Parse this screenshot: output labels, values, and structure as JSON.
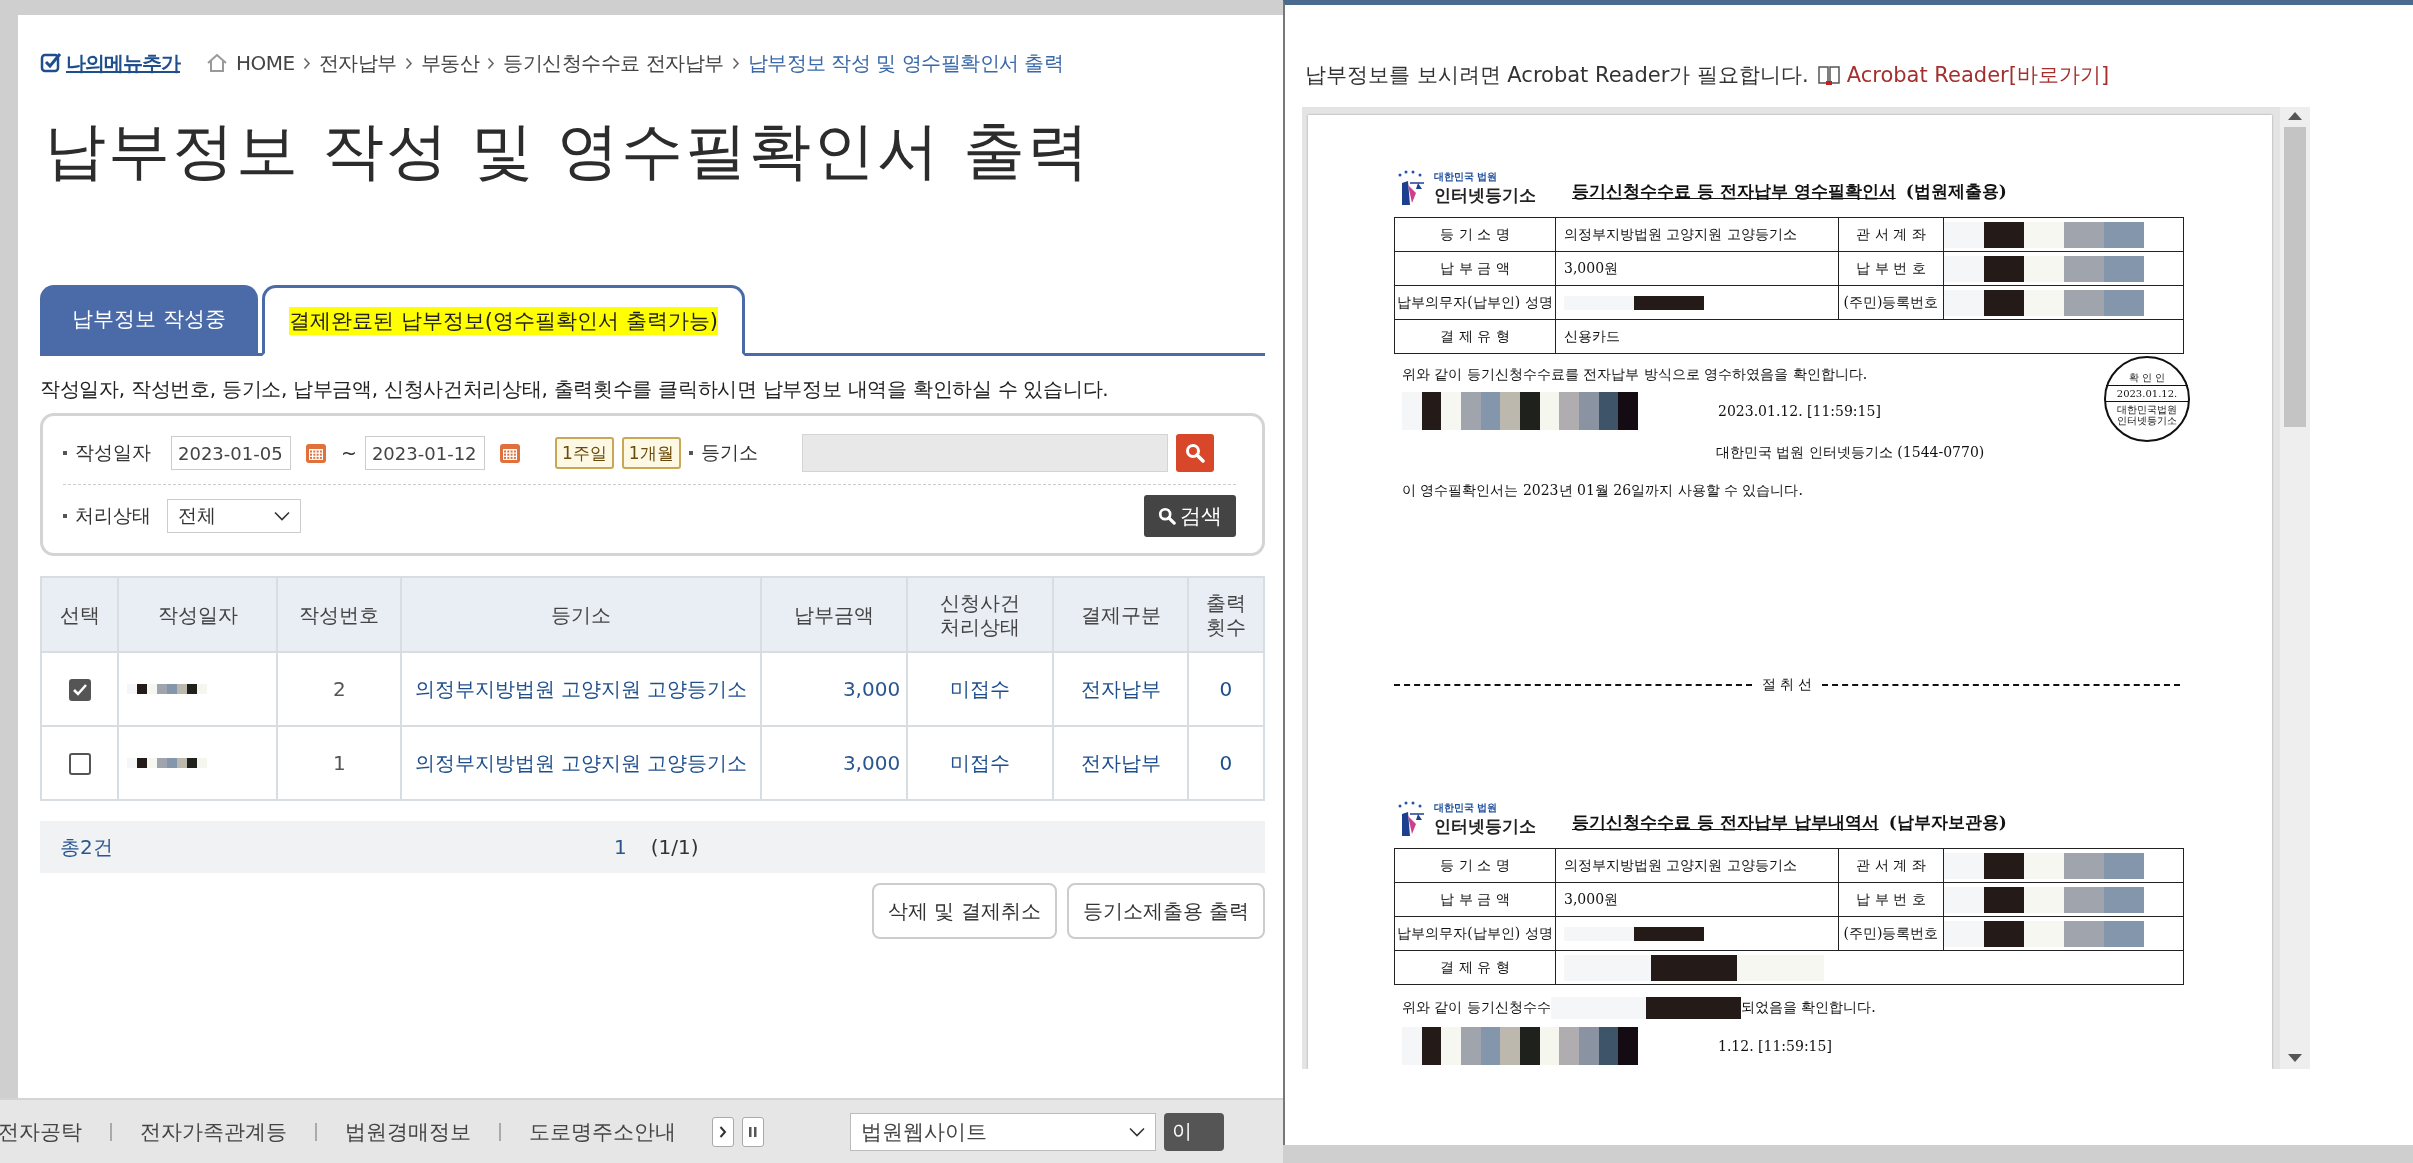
{
  "page": {
    "my_menu": "나의메뉴추가",
    "breadcrumb": [
      "HOME",
      "전자납부",
      "부동산",
      "등기신청수수료 전자납부",
      "납부정보 작성 및 영수필확인서 출력"
    ],
    "title": "납부정보 작성 및 영수필확인서 출력",
    "tabs": [
      {
        "label": "납부정보 작성중",
        "selected": false
      },
      {
        "label": "결제완료된 납부정보(영수필확인서 출력가능)",
        "selected": true
      }
    ],
    "instruction": "작성일자, 작성번호, 등기소, 납부금액, 신청사건처리상태, 출력횟수를 클릭하시면 납부정보 내역을 확인하실 수 있습니다.",
    "search": {
      "date_label": "작성일자",
      "date_from": "2023-01-05",
      "date_separator": "~",
      "date_to": "2023-01-12",
      "quick_buttons": [
        "1주일",
        "1개월"
      ],
      "office_label": "등기소",
      "status_label": "처리상태",
      "status_value": "전체",
      "search_button": "검색"
    },
    "table": {
      "columns": [
        "선택",
        "작성일자",
        "작성번호",
        "등기소",
        "납부금액",
        "신청사건 처리상태",
        "결제구분",
        "출력 횟수"
      ],
      "rows": [
        {
          "checked": true,
          "number": "2",
          "office": "의정부지방법원 고양지원 고양등기소",
          "amount": "3,000",
          "status": "미접수",
          "payment": "전자납부",
          "prints": "0"
        },
        {
          "checked": false,
          "number": "1",
          "office": "의정부지방법원 고양지원 고양등기소",
          "amount": "3,000",
          "status": "미접수",
          "payment": "전자납부",
          "prints": "0"
        }
      ]
    },
    "summary": {
      "total": "총2건",
      "page": "1",
      "page_info": "(1/1)"
    },
    "buttons": [
      "삭제 및 결제취소",
      "등기소제출용 출력"
    ]
  },
  "footer": {
    "links": [
      "전자공탁",
      "전자가족관계등",
      "법원경매정보",
      "도로명주소안내"
    ],
    "site_select": "법원웹사이트",
    "go_button": "이"
  },
  "popup": {
    "notice": "납부정보를 보시려면 Acrobat Reader가 필요합니다.",
    "link": "Acrobat Reader[바로가기]",
    "receipts": [
      {
        "logo_small": "대한민국 법원",
        "logo_name": "인터넷등기소",
        "title": "등기신청수수료 등 전자납부 영수필확인서",
        "subtitle": "(법원제출용)",
        "rows": [
          {
            "label": "등 기 소 명",
            "value": "의정부지방법원 고양지원 고양등기소",
            "label_2": "관 서 계 좌"
          },
          {
            "label": "납 부 금 액",
            "value": "3,000원",
            "label_2": "납 부 번 호"
          },
          {
            "label": "납부의무자(납부인) 성명",
            "label_2": "(주민)등록번호"
          },
          {
            "label": "결 제 유 형",
            "value": "신용카드"
          }
        ],
        "confirm": [
          "위와 같이 등기신청수수료를 전자납부 방식으로 영수하였음을 확인합니다."
        ],
        "timestamp": "2023.01.12. [11:59:15]",
        "issuer": "대한민국 법원  인터넷등기소 (1544-0770)",
        "stamp": {
          "title": "확 인 인",
          "date": "2023.01.12.",
          "lines": [
            "대한민국법원",
            "인터넷등기소"
          ]
        },
        "validity": "이 영수필확인서는 2023년 01월 26일까지 사용할 수 있습니다."
      },
      {
        "logo_small": "대한민국 법원",
        "logo_name": "인터넷등기소",
        "title": "등기신청수수료 등 전자납부 납부내역서",
        "subtitle": "(납부자보관용)",
        "rows": [
          {
            "label": "등 기 소 명",
            "value": "의정부지방법원 고양지원 고양등기소",
            "label_2": "관 서 계 좌"
          },
          {
            "label": "납 부 금 액",
            "value": "3,000원",
            "label_2": "납 부 번 호"
          },
          {
            "label": "납부의무자(납부인) 성명",
            "label_2": "(주민)등록번호"
          },
          {
            "label": "결 제 유 형"
          }
        ],
        "confirm": [
          "위와 같이 등기신청수수",
          "되었음을 확인합니다."
        ],
        "timestamp": "1.12. [11:59:15]"
      }
    ],
    "cut_line": "절 취 선"
  }
}
